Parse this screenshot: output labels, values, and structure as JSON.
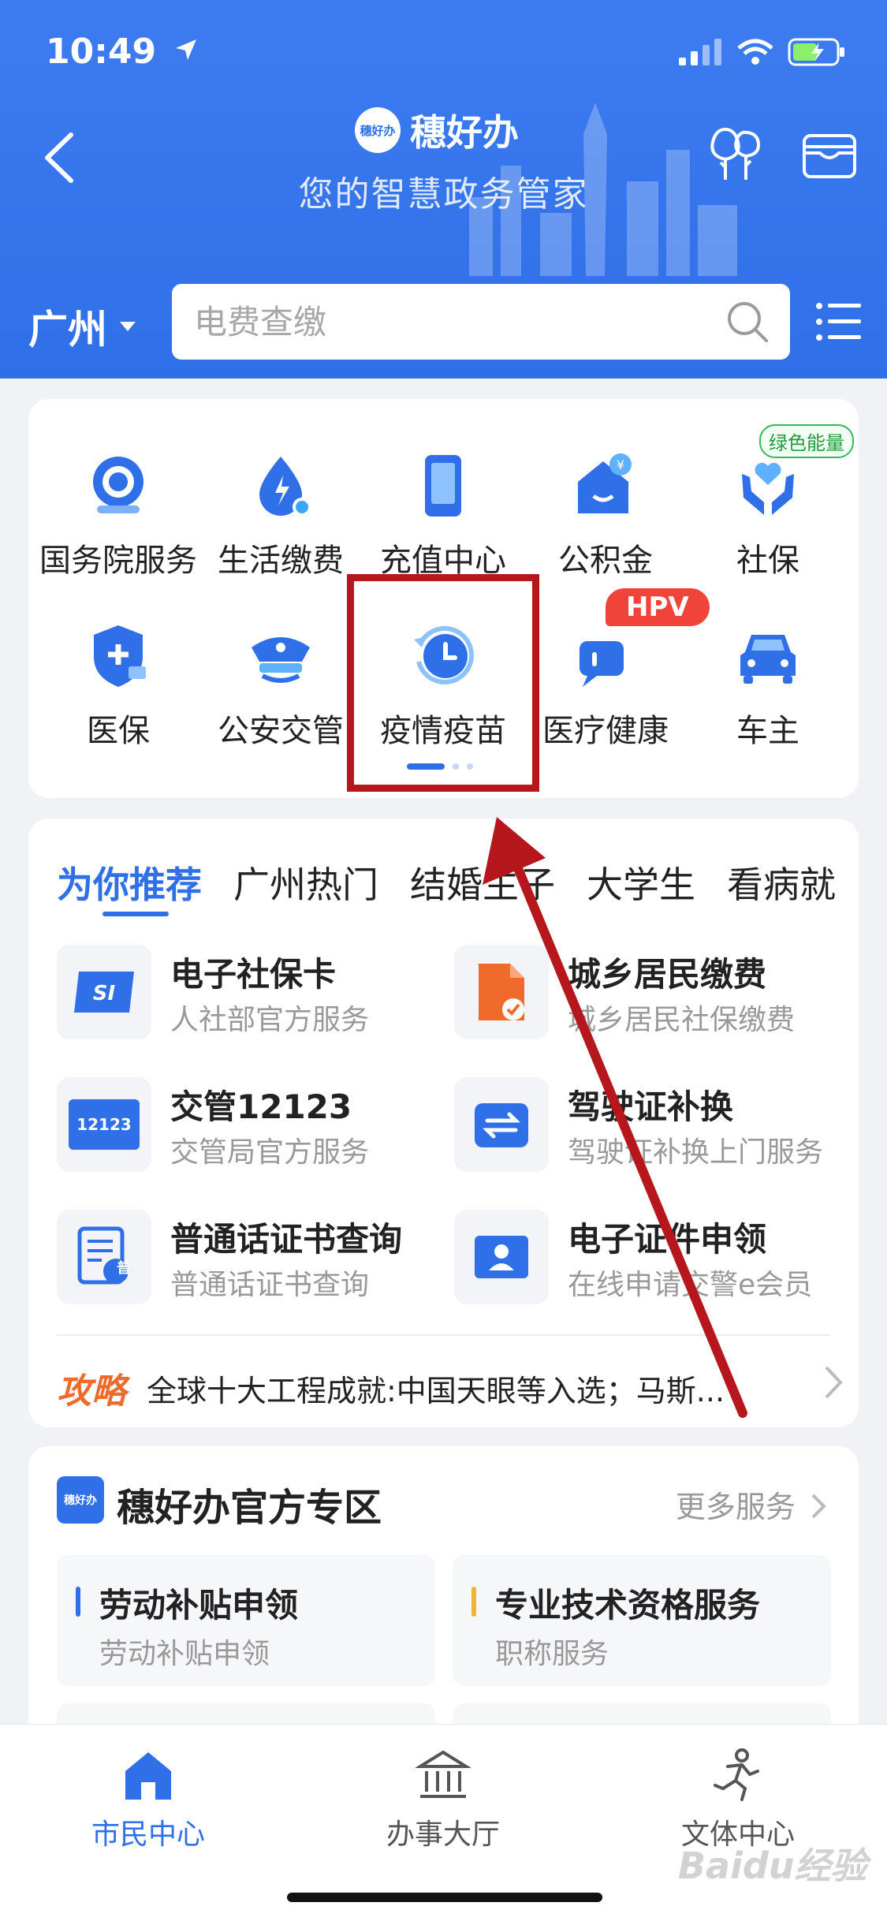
{
  "status": {
    "time": "10:49"
  },
  "header": {
    "brand_name": "穗好办",
    "logo_text": "穗好办",
    "subtitle": "您的智慧政务管家",
    "city": "广州",
    "search_placeholder": "电费查缴"
  },
  "services": {
    "row1": [
      "国务院服务",
      "生活缴费",
      "充值中心",
      "公积金",
      "社保"
    ],
    "row2": [
      "医保",
      "公安交管",
      "疫情疫苗",
      "医疗健康",
      "车主"
    ],
    "green_tag": "绿色能量",
    "hpv_tag": "HPV",
    "page_indicator": {
      "current": 1,
      "total": 3
    }
  },
  "recommend": {
    "tabs": [
      "为你推荐",
      "广州热门",
      "结婚生子",
      "大学生",
      "看病就"
    ],
    "items": [
      {
        "title": "电子社保卡",
        "subtitle": "人社部官方服务",
        "icon": "social-security-card-icon"
      },
      {
        "title": "城乡居民缴费",
        "subtitle": "城乡居民社保缴费",
        "icon": "tax-document-icon"
      },
      {
        "title": "交管12123",
        "subtitle": "交管局官方服务",
        "icon": "traffic-12123-icon",
        "icon_text": "12123"
      },
      {
        "title": "驾驶证补换",
        "subtitle": "驾驶证补换上门服务",
        "icon": "license-exchange-icon"
      },
      {
        "title": "普通话证书查询",
        "subtitle": "普通话证书查询",
        "icon": "mandarin-certificate-icon",
        "icon_text": "普"
      },
      {
        "title": "电子证件申领",
        "subtitle": "在线申请交警e会员",
        "icon": "e-id-icon"
      }
    ],
    "guide_label": "攻略",
    "guide_text": "全球十大工程成就:中国天眼等入选；马斯..."
  },
  "zone": {
    "title": "穗好办官方专区",
    "logo_text": "穗好办",
    "more": "更多服务",
    "cards": [
      {
        "title": "劳动补贴申领",
        "subtitle": "劳动补贴申领",
        "accent": "#2f6fe8"
      },
      {
        "title": "专业技术资格服务",
        "subtitle": "职称服务",
        "accent": "#f2b533"
      }
    ]
  },
  "tabbar": [
    "市民中心",
    "办事大厅",
    "文体中心"
  ],
  "watermark": "Baidu经验",
  "colors": {
    "primary": "#2f6fe8",
    "highlight_box": "#b5171d",
    "hpv": "#f0433a",
    "guide": "#f06a2b"
  }
}
